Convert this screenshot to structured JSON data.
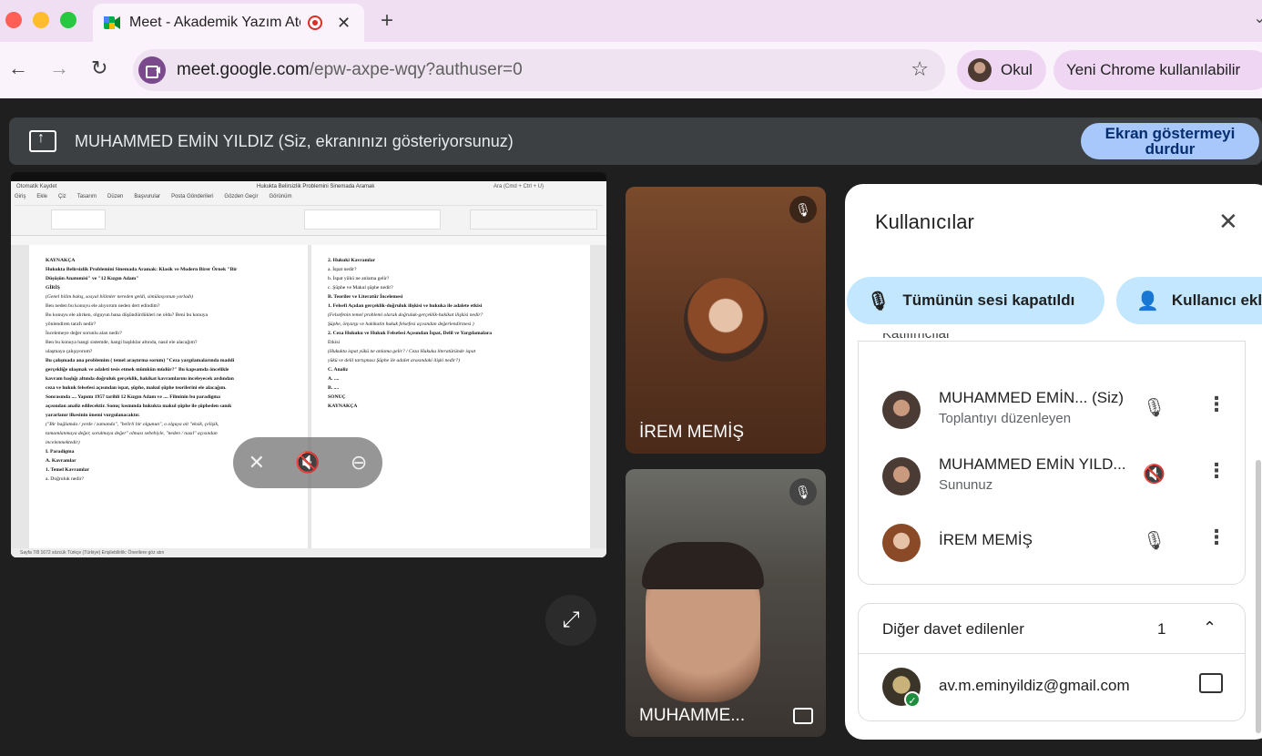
{
  "browser": {
    "tab": {
      "title": "Meet - Akademik Yazım Atölyesi",
      "close": "✕"
    },
    "new_tab": "+",
    "address": {
      "host": "meet.google.com",
      "path": "/epw-axpe-wqy?authuser=0"
    },
    "profile_label": "Okul",
    "update_label": "Yeni Chrome kullanılabilir",
    "icons": {
      "back": "←",
      "forward": "→",
      "reload": "↻",
      "star": "☆",
      "menu": "⋮"
    }
  },
  "meet": {
    "share_banner": {
      "text": "MUHAMMED EMİN YILDIZ (Siz, ekranınızı gösteriyorsunuz)",
      "stop_line1": "Ekran göstermeyi",
      "stop_line2": "durdur"
    },
    "shared_doc": {
      "title": "Hukukta Belirsizlik Problemini Sinemada Aramak",
      "search_placeholder": "Ara (Cmd + Ctrl + U)",
      "autosave": "Otomatik Kaydet",
      "menu": [
        "Giriş",
        "Ekle",
        "Çiz",
        "Tasarım",
        "Düzen",
        "Başvurular",
        "Posta Gönderileri",
        "Gözden Geçir",
        "Görünüm"
      ],
      "page_left": [
        "KAYNAKÇA",
        "Hukukta Belirsizlik Problemini Sinemada Aramak: Klasik ve Modern Birer Örnek \"Bir",
        "Düşüşün Anatomisi\" ve \"12 Kızgın Adam\"",
        "GİRİŞ",
        "(Genel bilim bakış, sosyal bilimler nereden geldi, simülasyonun yorladı)",
        "Ben neden bu konuyu ele alıyorum neden dert edindim?",
        "Bu konuyu ele alırken, olguyun bana düşündürdükleri ne oldu? Beni bu konuya",
        "yönlendiren tarafı nedir?",
        "İncelemeye değer sorunlu alan nedir?",
        "Ben bu konuya hangi sistemde, hangi başlıklar altında, nasıl ele alacağım?",
        "ulaşmaya çalışıyorum?",
        "Bu çalışmada ana problemim ( temel araştırma sorum) \"Ceza yargılamalarında maddi",
        "gerçekliğe ulaşmak ve adaleti tesis etmek mümkün müdür?\" Bu kapsamda öncelikle",
        "kavram başlığı altında doğruluk gerçeklik, hakikat kavramlarını inceleyecek ardından",
        "ceza ve hukuk felsefesi açısından ispat, şüphe, makul şüphe teorilerini ele alacağım.",
        "Sonrasında .... Yapımı 1957 tarihli 12 Kızgın Adam ve .... Filminin bu paradigma",
        "açısından analiz edilecektir. Sonuç kısmında hukukta makul şüphe ile şüpheden sanık",
        "yararlanır ilkesinin önemi vurgulanacaktır.",
        "(\"Bir bağlamda / yerde / zamanda\", \"belirli bir olgunun\", o olguya ait \"eksik, çelişik,",
        "tamamlanmaya değer, sorulmaya değer\" olması sebebiyle, \"neden / nasıl\" açısından",
        "incelenmektedir)",
        "I.      Paradigma",
        "A.  Kavramlar",
        "1.   Temel Kavramlar",
        "a.  Doğruluk nedir?"
      ],
      "page_right": [
        "2.   Hukuki Kavramlar",
        "a.  İspat nedir?",
        "b.  İspat yükü ne anlama gelir?",
        "c.  Şüphe ve Makul şüphe nedir?",
        "B.   Teoriler ve Literatür İncelemesi",
        "1.   Felsefi Açıdan gerçeklik-doğruluk ilişkisi ve hukuka ile adalete etkisi",
        "(Felsefenin temel problemi olarak doğruluk-gerçeklik-hakikat ilişkisi nedir?",
        "Şüphe, önyargı ve hakikatin hukuk felsefesi açısından değerlendirmesi )",
        "2.   Ceza Hukuku ve Hukuk Felsefesi Açısından İspat, Delil ve Yargılamalara",
        "Etkisi",
        "(Hukukta ispat yükü ne anlama gelir? / Ceza Hukuku literatüründe ispat",
        "yükü ve delil tartışması Şüphe ile adalet arasındaki ilişki nedir?)",
        "C.   Analiz",
        "A.  ....",
        "B.  ....",
        "SONUÇ",
        "KAYNAKÇA"
      ],
      "status": "Sayfa 7/8    1672 sözcük    Türkçe (Türkiye)    Erişilebilirlik: Önerilere göz atın"
    },
    "tiles": [
      {
        "name": "İREM MEMİŞ"
      },
      {
        "name": "MUHAMME..."
      }
    ]
  },
  "panel": {
    "title": "Kullanıcılar",
    "mute_all": "Tümünün sesi kapatıldı",
    "add_people": "Kullanıcı ekle",
    "participants_header": "Katılımcılar",
    "participants": [
      {
        "name": "MUHAMMED EMİN... (Siz)",
        "role": "Toplantıyı düzenleyen"
      },
      {
        "name": "MUHAMMED EMİN YILD...",
        "role": "Sununuz"
      },
      {
        "name": "İREM MEMİŞ",
        "role": ""
      }
    ],
    "invited": {
      "title": "Diğer davet edilenler",
      "count": "1",
      "email": "av.m.eminyildiz@gmail.com"
    }
  }
}
